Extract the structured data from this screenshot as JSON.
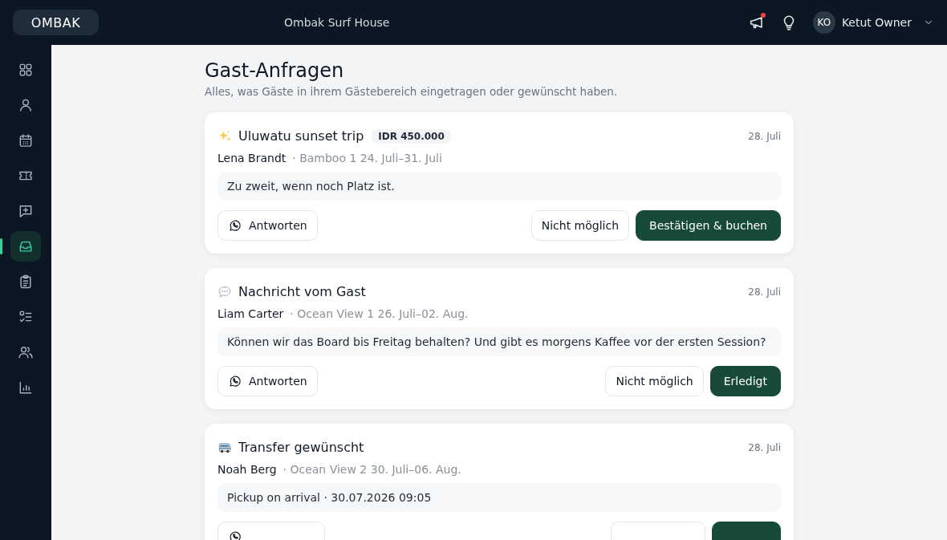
{
  "topbar": {
    "logo": "OMBAK",
    "property": "Ombak Surf House",
    "notification_dot": true,
    "user": {
      "initials": "KO",
      "name": "Ketut Owner"
    }
  },
  "sidebar": {
    "items": [
      {
        "kind": "grid",
        "selected": false
      },
      {
        "kind": "person",
        "selected": false
      },
      {
        "kind": "calendar",
        "selected": false
      },
      {
        "kind": "ticket",
        "selected": false
      },
      {
        "kind": "message-plus",
        "selected": false
      },
      {
        "kind": "inbox",
        "selected": true
      },
      {
        "kind": "clipboard",
        "selected": false
      },
      {
        "kind": "checklist",
        "selected": false
      },
      {
        "kind": "people",
        "selected": false
      },
      {
        "kind": "chart",
        "selected": false
      }
    ]
  },
  "page": {
    "title": "Gast-Anfragen",
    "subtitle": "Alles, was Gäste in ihrem Gästebereich eingetragen oder gewünscht haben."
  },
  "requests": [
    {
      "kind": "sparkle",
      "title": "Uluwatu sunset trip",
      "price": "IDR 450.000",
      "date": "28. Juli",
      "guest": "Lena Brandt",
      "stay": "· Bamboo 1 24. Juli–31. Juli",
      "message": "Zu zweit, wenn noch Platz ist.",
      "reply": "Antworten",
      "decline": "Nicht möglich",
      "confirm": "Bestätigen & buchen"
    },
    {
      "kind": "speech",
      "title": "Nachricht vom Gast",
      "date": "28. Juli",
      "guest": "Liam Carter",
      "stay": "· Ocean View 1 26. Juli–02. Aug.",
      "message": "Können wir das Board bis Freitag behalten? Und gibt es morgens Kaffee vor der ersten Session?",
      "reply": "Antworten",
      "decline": "Nicht möglich",
      "confirm": "Erledigt"
    },
    {
      "kind": "van",
      "title": "Transfer gewünscht",
      "date": "28. Juli",
      "guest": "Noah Berg",
      "stay": "· Ocean View 2 30. Juli–06. Aug.",
      "message": "Pickup on arrival · 30.07.2026 09:05"
    }
  ]
}
